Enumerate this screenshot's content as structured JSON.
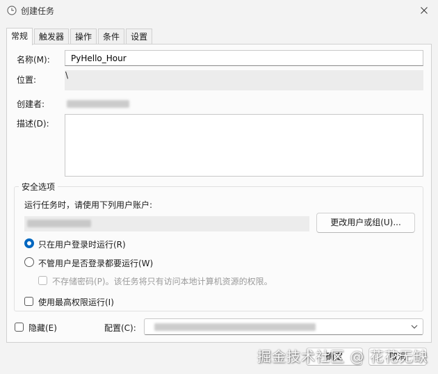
{
  "window": {
    "title": "创建任务"
  },
  "tabs": [
    {
      "label": "常规",
      "active": true
    },
    {
      "label": "触发器"
    },
    {
      "label": "操作"
    },
    {
      "label": "条件"
    },
    {
      "label": "设置"
    }
  ],
  "general": {
    "name_label": "名称(M):",
    "name_value": "PyHello_Hour",
    "location_label": "位置:",
    "location_value": "\\",
    "author_label": "创建者:",
    "description_label": "描述(D):"
  },
  "security": {
    "title": "安全选项",
    "run_as_prompt": "运行任务时，请使用下列用户账户:",
    "change_user_button": "更改用户或组(U)...",
    "radio_logged_on": "只在用户登录时运行(R)",
    "radio_whether_logged": "不管用户是否登录都要运行(W)",
    "no_store_password": "不存储密码(P)。该任务将只有访问本地计算机资源的权限。",
    "highest_privileges": "使用最高权限运行(I)"
  },
  "footer": {
    "hidden_label": "隐藏(E)",
    "config_label": "配置(C):",
    "ok_button": "确定",
    "cancel_button": "取消"
  },
  "watermark": "掘金技术社区 @ 花花无缺",
  "colors": {
    "accent": "#0067c0",
    "panel_bg": "#fbfbfb",
    "window_bg": "#f3f3f3"
  }
}
